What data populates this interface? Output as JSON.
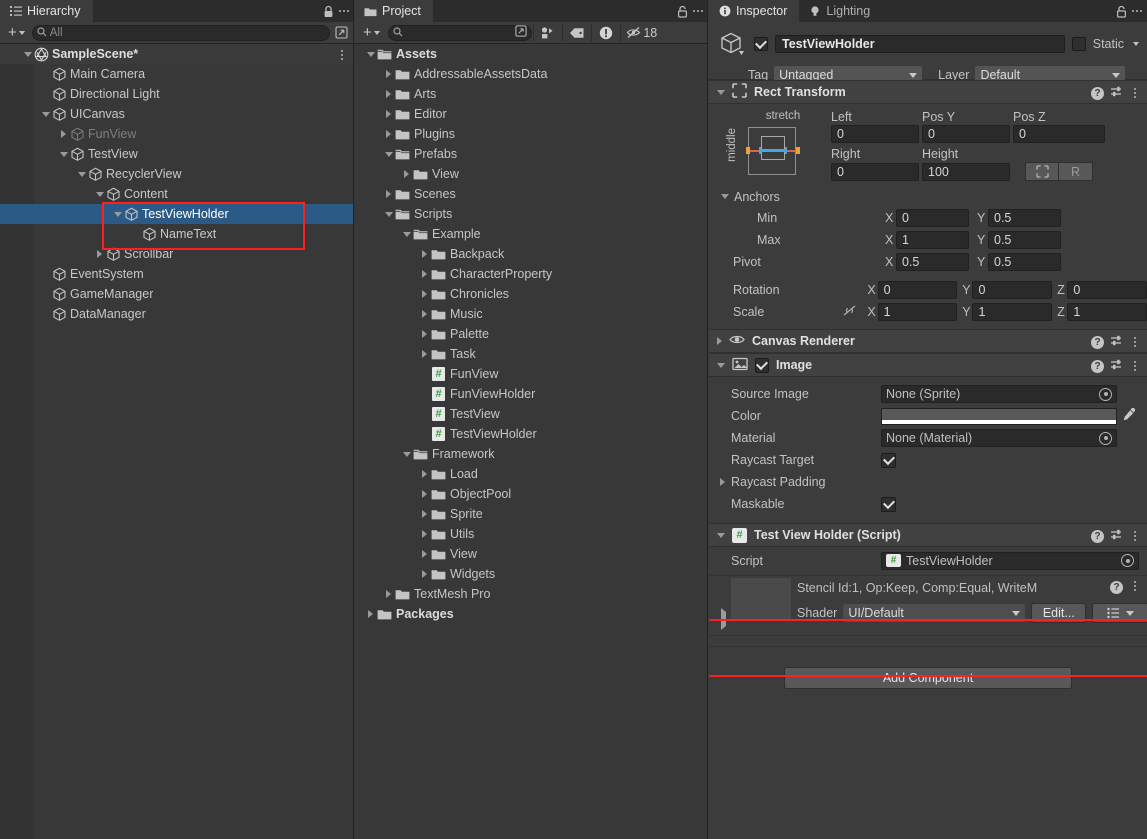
{
  "hierarchy": {
    "tab_label": "Hierarchy",
    "tab_icon": "hierarchy-icon",
    "lock_icon": "lock-closed-icon",
    "toolbar": {
      "add_label": "+",
      "search_placeholder": "All",
      "search_value": "All",
      "search_icon": "search-icon",
      "picker_icon": "picker-icon"
    },
    "rows": [
      {
        "label": "SampleScene*",
        "indent": 1,
        "toggle": "down",
        "icon": "unity-scene-icon",
        "state": "scene",
        "menu": true
      },
      {
        "label": "Main Camera",
        "indent": 2,
        "toggle": "none",
        "icon": "gameobject-icon",
        "state": "normal"
      },
      {
        "label": "Directional Light",
        "indent": 2,
        "toggle": "none",
        "icon": "gameobject-icon",
        "state": "normal"
      },
      {
        "label": "UICanvas",
        "indent": 2,
        "toggle": "down",
        "icon": "gameobject-icon",
        "state": "normal"
      },
      {
        "label": "FunView",
        "indent": 3,
        "toggle": "right",
        "icon": "gameobject-icon",
        "state": "dim"
      },
      {
        "label": "TestView",
        "indent": 3,
        "toggle": "down",
        "icon": "gameobject-icon",
        "state": "normal"
      },
      {
        "label": "RecyclerView",
        "indent": 4,
        "toggle": "down",
        "icon": "gameobject-icon",
        "state": "normal"
      },
      {
        "label": "Content",
        "indent": 5,
        "toggle": "down",
        "icon": "gameobject-icon",
        "state": "normal"
      },
      {
        "label": "TestViewHolder",
        "indent": 6,
        "toggle": "down",
        "icon": "gameobject-icon",
        "state": "selected"
      },
      {
        "label": "NameText",
        "indent": 7,
        "toggle": "none",
        "icon": "gameobject-icon",
        "state": "normal"
      },
      {
        "label": "Scrollbar",
        "indent": 5,
        "toggle": "right",
        "icon": "gameobject-icon",
        "state": "normal"
      },
      {
        "label": "EventSystem",
        "indent": 2,
        "toggle": "none",
        "icon": "gameobject-icon",
        "state": "normal"
      },
      {
        "label": "GameManager",
        "indent": 2,
        "toggle": "none",
        "icon": "gameobject-icon",
        "state": "normal"
      },
      {
        "label": "DataManager",
        "indent": 2,
        "toggle": "none",
        "icon": "gameobject-icon",
        "state": "normal"
      }
    ]
  },
  "project": {
    "tab_label": "Project",
    "tab_icon": "folder-icon",
    "lock_icon": "lock-open-icon",
    "toolbar": {
      "add_label": "+",
      "search_placeholder": "",
      "search_icon": "search-icon",
      "picker_icon": "picker-icon",
      "filter_type_icon": "filter-by-type-icon",
      "filter_label_icon": "filter-by-label-icon",
      "error_icon": "error-filter-icon",
      "hidden_icon": "hidden-packages-icon",
      "hidden_count": "18"
    },
    "rows": [
      {
        "label": "Assets",
        "indent": 0,
        "toggle": "down",
        "icon": "folder-open-icon",
        "bold": true
      },
      {
        "label": "AddressableAssetsData",
        "indent": 1,
        "toggle": "right",
        "icon": "folder-icon",
        "bold": false
      },
      {
        "label": "Arts",
        "indent": 1,
        "toggle": "right",
        "icon": "folder-icon",
        "bold": false
      },
      {
        "label": "Editor",
        "indent": 1,
        "toggle": "right",
        "icon": "folder-icon",
        "bold": false
      },
      {
        "label": "Plugins",
        "indent": 1,
        "toggle": "right",
        "icon": "folder-icon",
        "bold": false
      },
      {
        "label": "Prefabs",
        "indent": 1,
        "toggle": "down",
        "icon": "folder-open-icon",
        "bold": false
      },
      {
        "label": "View",
        "indent": 2,
        "toggle": "right",
        "icon": "folder-icon",
        "bold": false
      },
      {
        "label": "Scenes",
        "indent": 1,
        "toggle": "right",
        "icon": "folder-icon",
        "bold": false
      },
      {
        "label": "Scripts",
        "indent": 1,
        "toggle": "down",
        "icon": "folder-open-icon",
        "bold": false
      },
      {
        "label": "Example",
        "indent": 2,
        "toggle": "down",
        "icon": "folder-open-icon",
        "bold": false
      },
      {
        "label": "Backpack",
        "indent": 3,
        "toggle": "right",
        "icon": "folder-icon",
        "bold": false
      },
      {
        "label": "CharacterProperty",
        "indent": 3,
        "toggle": "right",
        "icon": "folder-icon",
        "bold": false
      },
      {
        "label": "Chronicles",
        "indent": 3,
        "toggle": "right",
        "icon": "folder-icon",
        "bold": false
      },
      {
        "label": "Music",
        "indent": 3,
        "toggle": "right",
        "icon": "folder-icon",
        "bold": false
      },
      {
        "label": "Palette",
        "indent": 3,
        "toggle": "right",
        "icon": "folder-icon",
        "bold": false
      },
      {
        "label": "Task",
        "indent": 3,
        "toggle": "right",
        "icon": "folder-icon",
        "bold": false
      },
      {
        "label": "FunView",
        "indent": 3,
        "toggle": "none",
        "icon": "csharp-script-icon",
        "bold": false
      },
      {
        "label": "FunViewHolder",
        "indent": 3,
        "toggle": "none",
        "icon": "csharp-script-icon",
        "bold": false
      },
      {
        "label": "TestView",
        "indent": 3,
        "toggle": "none",
        "icon": "csharp-script-icon",
        "bold": false
      },
      {
        "label": "TestViewHolder",
        "indent": 3,
        "toggle": "none",
        "icon": "csharp-script-icon",
        "bold": false
      },
      {
        "label": "Framework",
        "indent": 2,
        "toggle": "down",
        "icon": "folder-open-icon",
        "bold": false
      },
      {
        "label": "Load",
        "indent": 3,
        "toggle": "right",
        "icon": "folder-icon",
        "bold": false
      },
      {
        "label": "ObjectPool",
        "indent": 3,
        "toggle": "right",
        "icon": "folder-icon",
        "bold": false
      },
      {
        "label": "Sprite",
        "indent": 3,
        "toggle": "right",
        "icon": "folder-icon",
        "bold": false
      },
      {
        "label": "Utils",
        "indent": 3,
        "toggle": "right",
        "icon": "folder-icon",
        "bold": false
      },
      {
        "label": "View",
        "indent": 3,
        "toggle": "right",
        "icon": "folder-icon",
        "bold": false
      },
      {
        "label": "Widgets",
        "indent": 3,
        "toggle": "right",
        "icon": "folder-icon",
        "bold": false
      },
      {
        "label": "TextMesh Pro",
        "indent": 1,
        "toggle": "right",
        "icon": "folder-icon",
        "bold": false
      },
      {
        "label": "Packages",
        "indent": 0,
        "toggle": "right",
        "icon": "folder-icon",
        "bold": true
      }
    ]
  },
  "inspector": {
    "tabs": [
      {
        "label": "Inspector",
        "icon": "info-icon",
        "active": true
      },
      {
        "label": "Lighting",
        "icon": "lightbulb-icon",
        "active": false
      }
    ],
    "lock_icon": "lock-open-icon",
    "object_header": {
      "prefab_icon": "gameobject-icon",
      "enabled": true,
      "name": "TestViewHolder",
      "static_label": "Static",
      "static_checked": false,
      "tag_label": "Tag",
      "tag_value": "Untagged",
      "layer_label": "Layer",
      "layer_value": "Default"
    },
    "rect_transform": {
      "title": "Rect Transform",
      "icon": "rect-transform-icon",
      "anchor_preset_h": "stretch",
      "anchor_preset_v": "middle",
      "fields": [
        {
          "label": "Left",
          "value": "0"
        },
        {
          "label": "Pos Y",
          "value": "0"
        },
        {
          "label": "Pos Z",
          "value": "0"
        },
        {
          "label": "Right",
          "value": "0"
        },
        {
          "label": "Height",
          "value": "100"
        }
      ],
      "blueprint_icon": "blueprint-mode-icon",
      "raw_label": "R",
      "anchors_label": "Anchors",
      "min_label": "Min",
      "min_x": "0",
      "min_y": "0.5",
      "max_label": "Max",
      "max_x": "1",
      "max_y": "0.5",
      "pivot_label": "Pivot",
      "pivot_x": "0.5",
      "pivot_y": "0.5",
      "rotation_label": "Rotation",
      "rot_x": "0",
      "rot_y": "0",
      "rot_z": "0",
      "scale_label": "Scale",
      "scale_link_icon": "link-off-icon",
      "scale_x": "1",
      "scale_y": "1",
      "scale_z": "1"
    },
    "canvas_renderer": {
      "title": "Canvas Renderer",
      "icon": "eye-icon"
    },
    "image": {
      "title": "Image",
      "icon": "image-component-icon",
      "enabled": true,
      "source_image_label": "Source Image",
      "source_image_value": "None (Sprite)",
      "color_label": "Color",
      "color_value": "#585858",
      "color_alpha_value": "#ffffff",
      "eyedropper_icon": "eyedropper-icon",
      "material_label": "Material",
      "material_value": "None (Material)",
      "raycast_target_label": "Raycast Target",
      "raycast_target_checked": true,
      "raycast_padding_label": "Raycast Padding",
      "maskable_label": "Maskable",
      "maskable_checked": true
    },
    "script_component": {
      "title": "Test View Holder (Script)",
      "icon": "csharp-script-icon",
      "script_label": "Script",
      "script_value": "TestViewHolder",
      "highlight_color": "#ff1f1f"
    },
    "material": {
      "title": "Stencil Id:1, Op:Keep, Comp:Equal, WriteM",
      "shader_label": "Shader",
      "shader_value": "UI/Default",
      "edit_label": "Edit...",
      "preset_icon": "preset-list-icon"
    },
    "add_component_label": "Add Component"
  },
  "highlights": {
    "hierarchy_box_color": "#ff1f1f",
    "script_box_color": "#ff1f1f"
  }
}
